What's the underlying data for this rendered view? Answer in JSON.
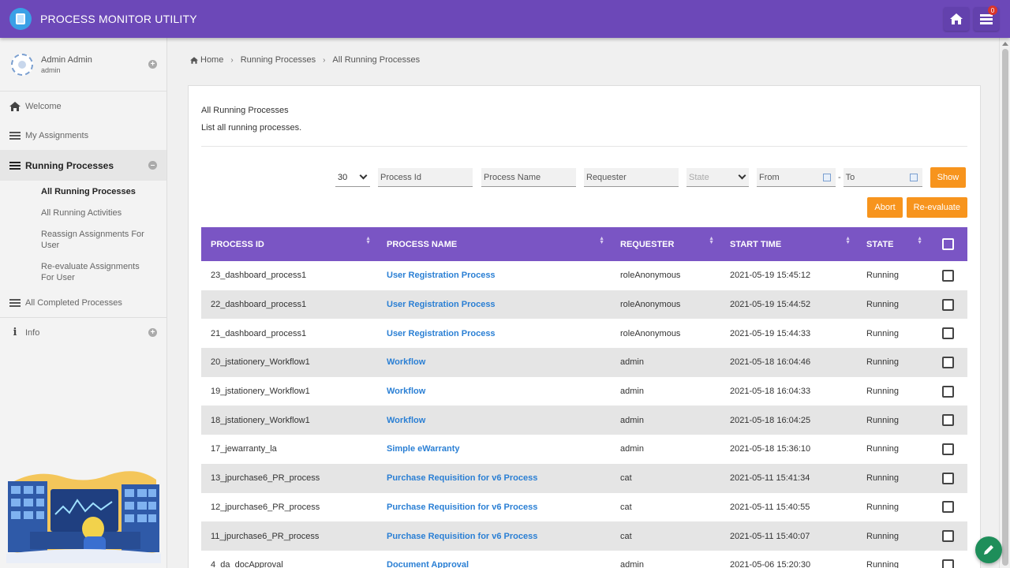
{
  "app": {
    "title": "PROCESS MONITOR UTILITY",
    "notification_count": "0"
  },
  "user": {
    "name": "Admin Admin",
    "role": "admin"
  },
  "sidebar": {
    "items": [
      {
        "label": "Welcome",
        "icon": "home-icon"
      },
      {
        "label": "My Assignments",
        "icon": "list-icon"
      },
      {
        "label": "Running Processes",
        "icon": "list-icon"
      },
      {
        "label": "All Completed Processes",
        "icon": "list-icon"
      },
      {
        "label": "Info",
        "icon": "info-icon"
      }
    ],
    "sub_items": [
      "All Running Processes",
      "All Running Activities",
      "Reassign Assignments For User",
      "Re-evaluate Assignments For User"
    ]
  },
  "breadcrumb": [
    "Home",
    "Running Processes",
    "All Running Processes"
  ],
  "panel": {
    "title": "All Running Processes",
    "description": "List all running processes."
  },
  "filters": {
    "page_size": "30",
    "process_id_placeholder": "Process Id",
    "process_name_placeholder": "Process Name",
    "requester_placeholder": "Requester",
    "state_placeholder": "State",
    "from_placeholder": "From",
    "range_separator": "-",
    "to_placeholder": "To",
    "show_label": "Show"
  },
  "actions": {
    "abort_label": "Abort",
    "reevaluate_label": "Re-evaluate"
  },
  "table": {
    "headers": [
      "PROCESS ID",
      "PROCESS NAME",
      "REQUESTER",
      "START TIME",
      "STATE"
    ],
    "rows": [
      [
        "23_dashboard_process1",
        "User Registration Process",
        "roleAnonymous",
        "2021-05-19 15:45:12",
        "Running"
      ],
      [
        "22_dashboard_process1",
        "User Registration Process",
        "roleAnonymous",
        "2021-05-19 15:44:52",
        "Running"
      ],
      [
        "21_dashboard_process1",
        "User Registration Process",
        "roleAnonymous",
        "2021-05-19 15:44:33",
        "Running"
      ],
      [
        "20_jstationery_Workflow1",
        "Workflow",
        "admin",
        "2021-05-18 16:04:46",
        "Running"
      ],
      [
        "19_jstationery_Workflow1",
        "Workflow",
        "admin",
        "2021-05-18 16:04:33",
        "Running"
      ],
      [
        "18_jstationery_Workflow1",
        "Workflow",
        "admin",
        "2021-05-18 16:04:25",
        "Running"
      ],
      [
        "17_jewarranty_la",
        "Simple eWarranty",
        "admin",
        "2021-05-18 15:36:10",
        "Running"
      ],
      [
        "13_jpurchase6_PR_process",
        "Purchase Requisition for v6 Process",
        "cat",
        "2021-05-11 15:41:34",
        "Running"
      ],
      [
        "12_jpurchase6_PR_process",
        "Purchase Requisition for v6 Process",
        "cat",
        "2021-05-11 15:40:55",
        "Running"
      ],
      [
        "11_jpurchase6_PR_process",
        "Purchase Requisition for v6 Process",
        "cat",
        "2021-05-11 15:40:07",
        "Running"
      ],
      [
        "4_da_docApproval",
        "Document Approval",
        "admin",
        "2021-05-06 15:20:30",
        "Running"
      ]
    ]
  }
}
